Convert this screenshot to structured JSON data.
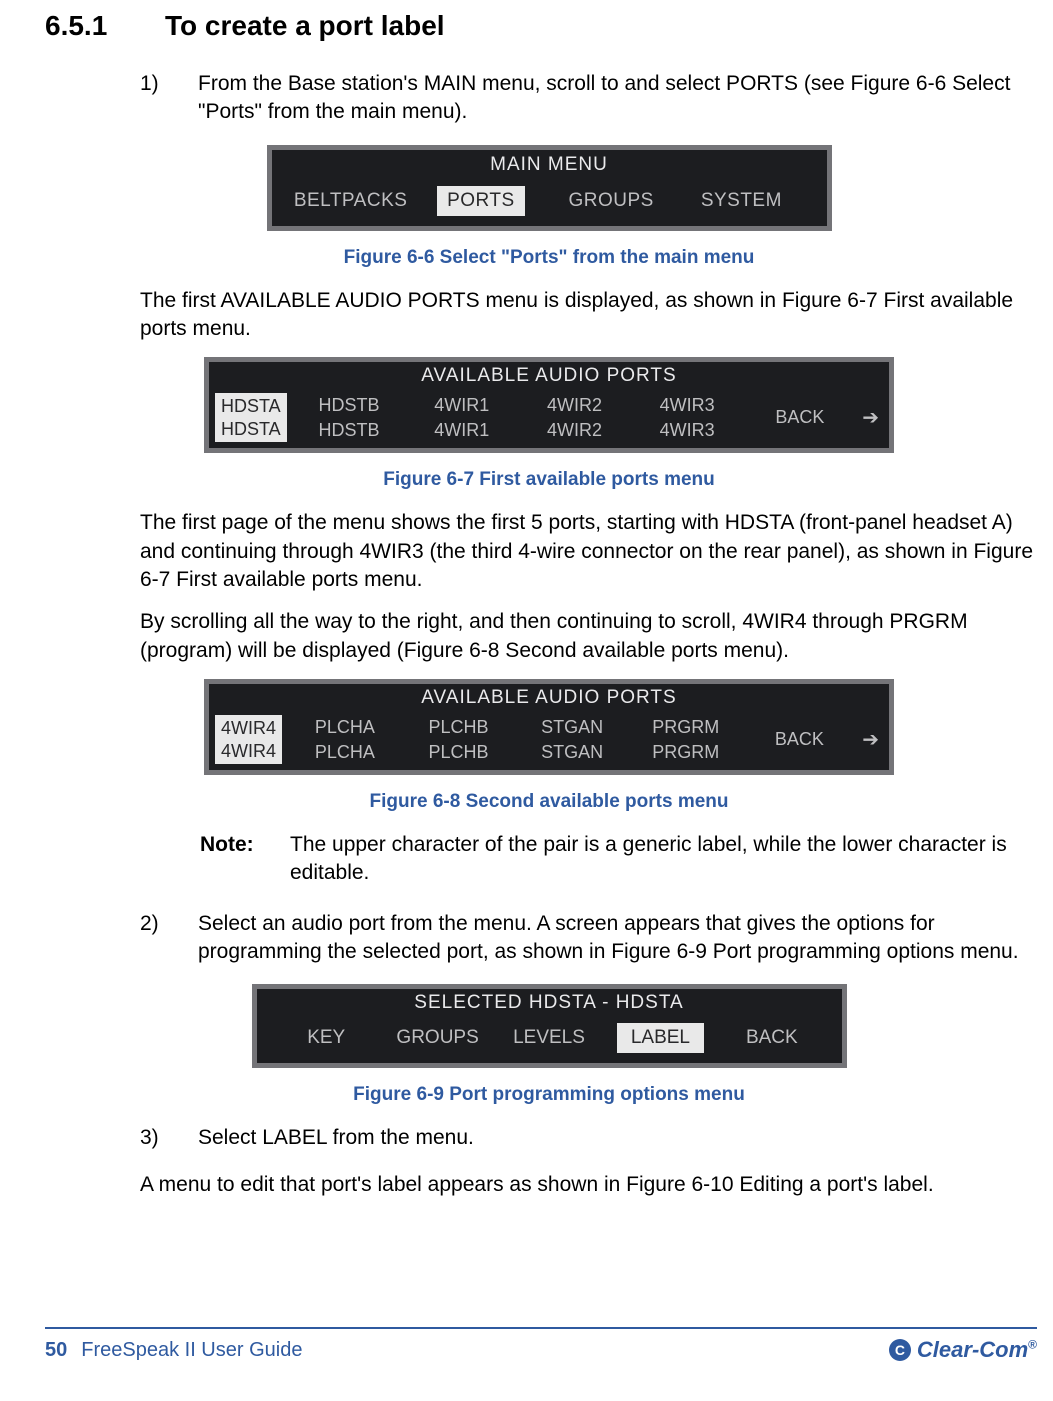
{
  "section": {
    "number": "6.5.1",
    "title": "To create a port label"
  },
  "steps": {
    "s1": {
      "num": "1)",
      "text": "From the Base station's MAIN menu, scroll to and select PORTS (see Figure 6-6 Select \"Ports\" from the main menu)."
    },
    "s2": {
      "num": "2)",
      "text": "Select an audio port from the menu. A screen appears that gives the options for programming the selected port, as shown in Figure 6-9 Port programming options menu."
    },
    "s3": {
      "num": "3)",
      "text": "Select LABEL from the menu."
    }
  },
  "paras": {
    "p1": "The first AVAILABLE AUDIO PORTS menu is displayed, as shown in Figure 6-7 First available ports menu.",
    "p2": "The first page of the menu shows the first 5 ports, starting with HDSTA (front-panel headset A) and continuing through 4WIR3 (the third 4-wire connector on the rear panel), as shown in Figure 6-7 First available ports menu.",
    "p3": "By scrolling all the way to the right, and then continuing to scroll, 4WIR4 through PRGRM (program) will be displayed (Figure 6-8 Second available ports menu).",
    "p4": "A menu to edit that port's label appears as shown in Figure 6-10 Editing a port's label."
  },
  "captions": {
    "c1": "Figure 6-6 Select \"Ports\" from the main menu",
    "c2": "Figure 6-7 First available ports menu",
    "c3": "Figure 6-8 Second available ports menu",
    "c4": "Figure 6-9 Port programming options menu"
  },
  "note": {
    "label": "Note:",
    "text": "The upper character of the pair is a generic label, while the lower character is editable."
  },
  "menus": {
    "main": {
      "title": "MAIN MENU",
      "items": [
        "BELTPACKS",
        "PORTS",
        "GROUPS",
        "SYSTEM"
      ],
      "selected": "PORTS"
    },
    "ports1": {
      "title": "AVAILABLE AUDIO PORTS",
      "sel_top": "HDSTA",
      "sel_bot": "HDSTA",
      "cols": [
        {
          "t": "HDSTB",
          "b": "HDSTB"
        },
        {
          "t": "4WIR1",
          "b": "4WIR1"
        },
        {
          "t": "4WIR2",
          "b": "4WIR2"
        },
        {
          "t": "4WIR3",
          "b": "4WIR3"
        }
      ],
      "back": "BACK"
    },
    "ports2": {
      "title": "AVAILABLE AUDIO PORTS",
      "sel_top": "4WIR4",
      "sel_bot": "4WIR4",
      "cols": [
        {
          "t": "PLCHA",
          "b": "PLCHA"
        },
        {
          "t": "PLCHB",
          "b": "PLCHB"
        },
        {
          "t": "STGAN",
          "b": "STGAN"
        },
        {
          "t": "PRGRM",
          "b": "PRGRM"
        }
      ],
      "back": "BACK"
    },
    "selected": {
      "title": "SELECTED HDSTA - HDSTA",
      "items": [
        "KEY",
        "GROUPS",
        "LEVELS",
        "LABEL",
        "BACK"
      ],
      "selected": "LABEL"
    }
  },
  "footer": {
    "page": "50",
    "doc": "FreeSpeak II User Guide",
    "brand": "Clear-Com"
  }
}
